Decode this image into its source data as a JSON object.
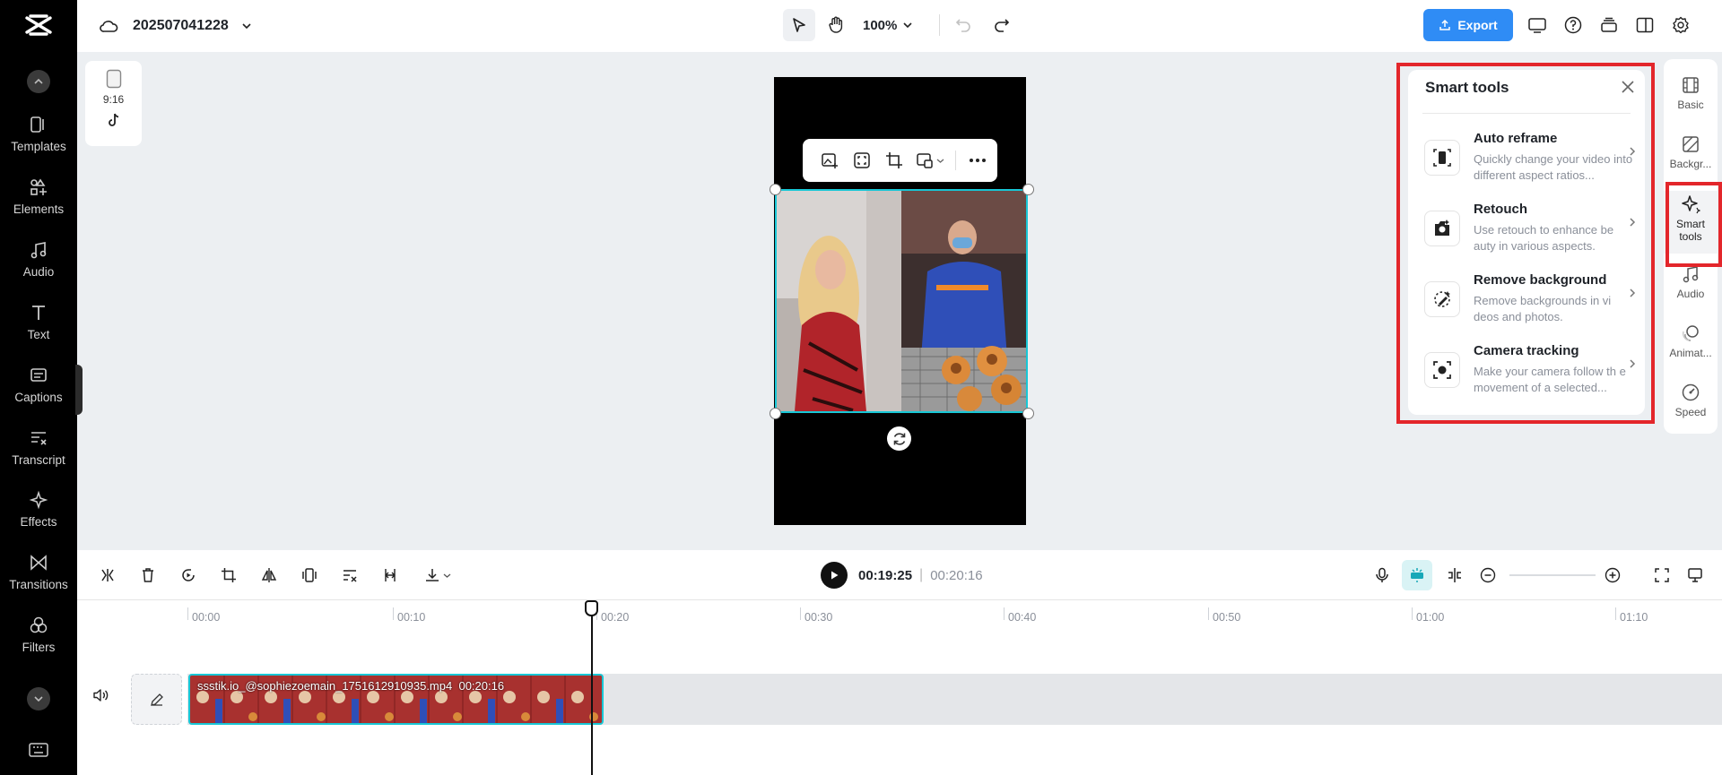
{
  "project": {
    "name": "202507041228"
  },
  "topbar": {
    "zoom": "100%",
    "export_label": "Export"
  },
  "sidebar": {
    "items": [
      {
        "label": "Templates",
        "icon": "templates-icon"
      },
      {
        "label": "Elements",
        "icon": "elements-icon"
      },
      {
        "label": "Audio",
        "icon": "music-note-icon"
      },
      {
        "label": "Text",
        "icon": "text-icon"
      },
      {
        "label": "Captions",
        "icon": "captions-icon"
      },
      {
        "label": "Transcript",
        "icon": "transcript-icon"
      },
      {
        "label": "Effects",
        "icon": "effects-icon"
      },
      {
        "label": "Transitions",
        "icon": "transitions-icon"
      },
      {
        "label": "Filters",
        "icon": "filters-icon"
      }
    ]
  },
  "canvas": {
    "aspect_ratio": "9:16"
  },
  "smart_tools": {
    "title": "Smart tools",
    "items": [
      {
        "name": "Auto reframe",
        "desc": "Quickly change your video into different aspect ratios..."
      },
      {
        "name": "Retouch",
        "desc": "Use retouch to enhance be auty in various aspects."
      },
      {
        "name": "Remove background",
        "desc": "Remove backgrounds in vi deos and photos."
      },
      {
        "name": "Camera tracking",
        "desc": "Make your camera follow th e movement of a selected..."
      }
    ]
  },
  "right_rail": {
    "items": [
      {
        "label": "Basic"
      },
      {
        "label": "Backgr..."
      },
      {
        "label": "Smart tools"
      },
      {
        "label": "Audio"
      },
      {
        "label": "Animat..."
      },
      {
        "label": "Speed"
      }
    ]
  },
  "timeline": {
    "current_time": "00:19:25",
    "separator": "|",
    "total_time": "00:20:16",
    "ruler": [
      "00:00",
      "00:10",
      "00:20",
      "00:30",
      "00:40",
      "00:50",
      "01:00",
      "01:10"
    ],
    "clip": {
      "filename": "ssstik.io_@sophiezoemain_1751612910935.mp4",
      "duration": "00:20:16"
    }
  },
  "colors": {
    "accent": "#2f8cf5",
    "selection": "#18c7d6",
    "highlight": "#e3262b"
  }
}
